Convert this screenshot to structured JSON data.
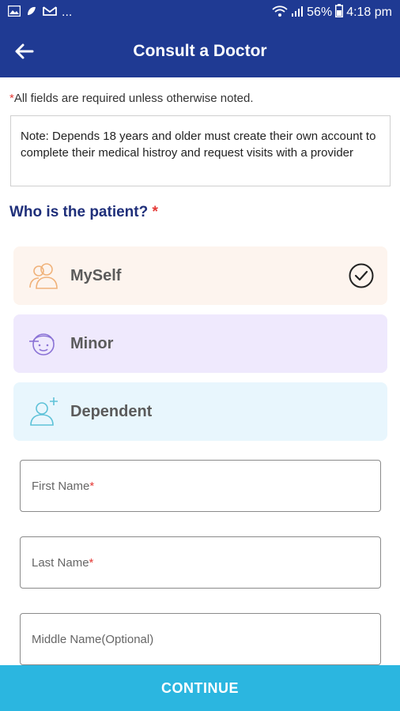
{
  "status_bar": {
    "overflow": "...",
    "battery": "56%",
    "time": "4:18 pm",
    "icons": [
      "gallery-icon",
      "app-icon",
      "mail-icon",
      "wifi-icon",
      "signal-icon",
      "battery-icon"
    ]
  },
  "app_bar": {
    "title": "Consult a Doctor",
    "back_icon": "arrow-left-icon"
  },
  "form": {
    "required_star": "*",
    "required_note": "All fields are required unless otherwise noted.",
    "note": "Note: Depends 18 years and older must create their own account to complete their medical histroy and request visits with a provider",
    "who_title": "Who is the patient?",
    "options": [
      {
        "label": "MySelf",
        "icon": "person-pair-icon",
        "selected": true,
        "bg": "#fdf4ee",
        "icon_color": "#f0b27a"
      },
      {
        "label": "Minor",
        "icon": "child-face-icon",
        "selected": false,
        "bg": "#efe9fd",
        "icon_color": "#8b73d6"
      },
      {
        "label": "Dependent",
        "icon": "person-add-icon",
        "selected": false,
        "bg": "#e8f6fd",
        "icon_color": "#5ec2d8"
      }
    ],
    "fields": [
      {
        "label": "First Name",
        "required": "*"
      },
      {
        "label": "Last Name",
        "required": "*"
      },
      {
        "label": "Middle Name(Optional)",
        "required": ""
      }
    ]
  },
  "continue_label": "CONTINUE",
  "colors": {
    "primary": "#1f3a93",
    "accent": "#2bb6e0",
    "required": "#e53935",
    "heading": "#1f2f7a"
  }
}
